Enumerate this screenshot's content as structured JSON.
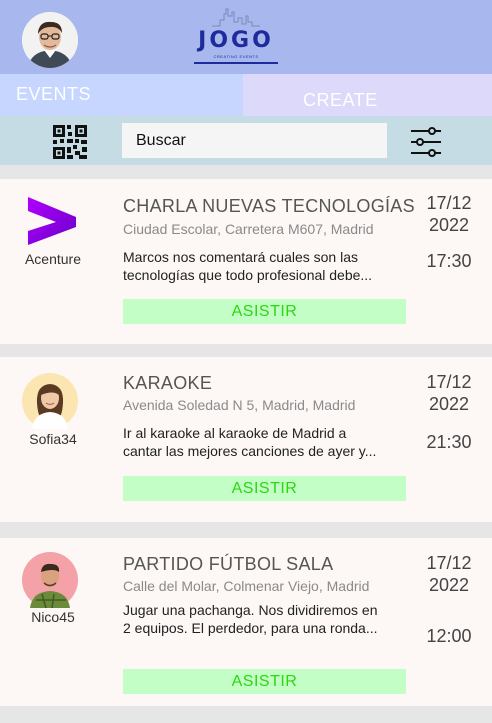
{
  "header": {
    "logo_text": "JOGO",
    "logo_subtitle": "CREATING EVENTS"
  },
  "tabs": {
    "events": "EVENTS",
    "create": "CREATE"
  },
  "search": {
    "value": "Buscar"
  },
  "colors": {
    "header": "#a9b7ef",
    "tab_events": "#c6d6ff",
    "tab_create": "#ddd9fb",
    "toolbar": "#c5dce4",
    "attend_bg": "#c3fec6",
    "attend_text": "#2bd80f",
    "brand": "#1e2b9c"
  },
  "events": [
    {
      "organizer": "Acenture",
      "title": "CHARLA NUEVAS TECNOLOGÍAS",
      "place": "Ciudad Escolar, Carretera M607, Madrid",
      "desc_line1": "Marcos nos comentará cuales son las",
      "desc_line2": "tecnologías que todo profesional debe...",
      "date_day": "17/12",
      "date_year": "2022",
      "time": "17:30",
      "button": "ASISTIR"
    },
    {
      "organizer": "Sofia34",
      "title": "KARAOKE",
      "place": "Avenida Soledad N 5, Madrid, Madrid",
      "desc_line1": "Ir al karaoke al karaoke de Madrid a",
      "desc_line2": "cantar las mejores canciones de ayer y...",
      "date_day": "17/12",
      "date_year": "2022",
      "time": "21:30",
      "button": "ASISTIR"
    },
    {
      "organizer": "Nico45",
      "title": "PARTIDO FÚTBOL SALA",
      "place": "Calle del Molar, Colmenar Viejo, Madrid",
      "desc_line1": "Jugar una pachanga. Nos dividiremos en",
      "desc_line2": "2 equipos. El perdedor, para una ronda...",
      "date_day": "17/12",
      "date_year": "2022",
      "time": "12:00",
      "button": "ASISTIR"
    }
  ]
}
